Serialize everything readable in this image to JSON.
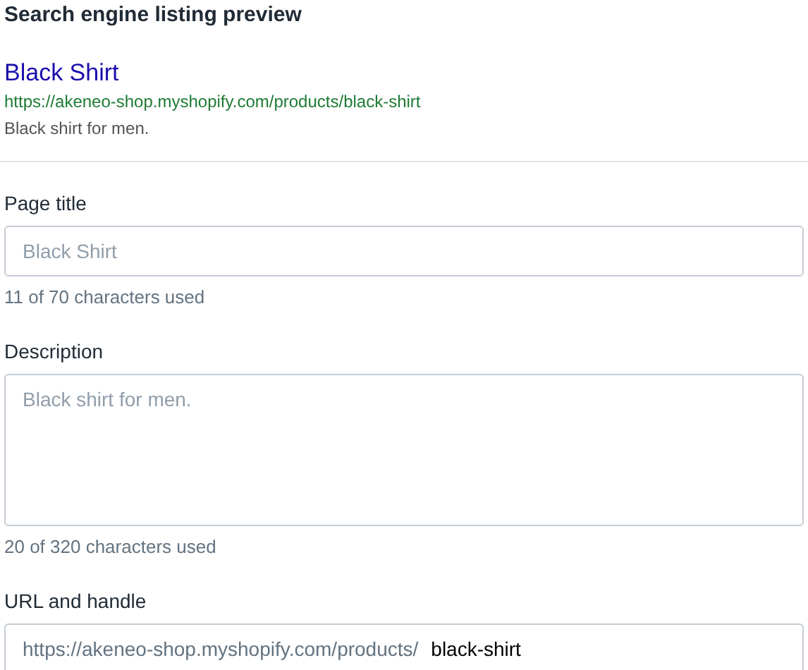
{
  "heading": "Search engine listing preview",
  "preview": {
    "title": "Black Shirt",
    "url": "https://akeneo-shop.myshopify.com/products/black-shirt",
    "description": "Black shirt for men."
  },
  "fields": [
    {
      "kind": "input",
      "label": "Page title",
      "placeholder": "Black Shirt",
      "counter": "11 of 70 characters used"
    },
    {
      "kind": "textarea",
      "label": "Description",
      "placeholder": "Black shirt for men.",
      "counter": "20 of 320 characters used"
    },
    {
      "kind": "prefixed",
      "label": "URL and handle",
      "prefix": "https://akeneo-shop.myshopify.com/products/",
      "value": "black-shirt"
    }
  ]
}
